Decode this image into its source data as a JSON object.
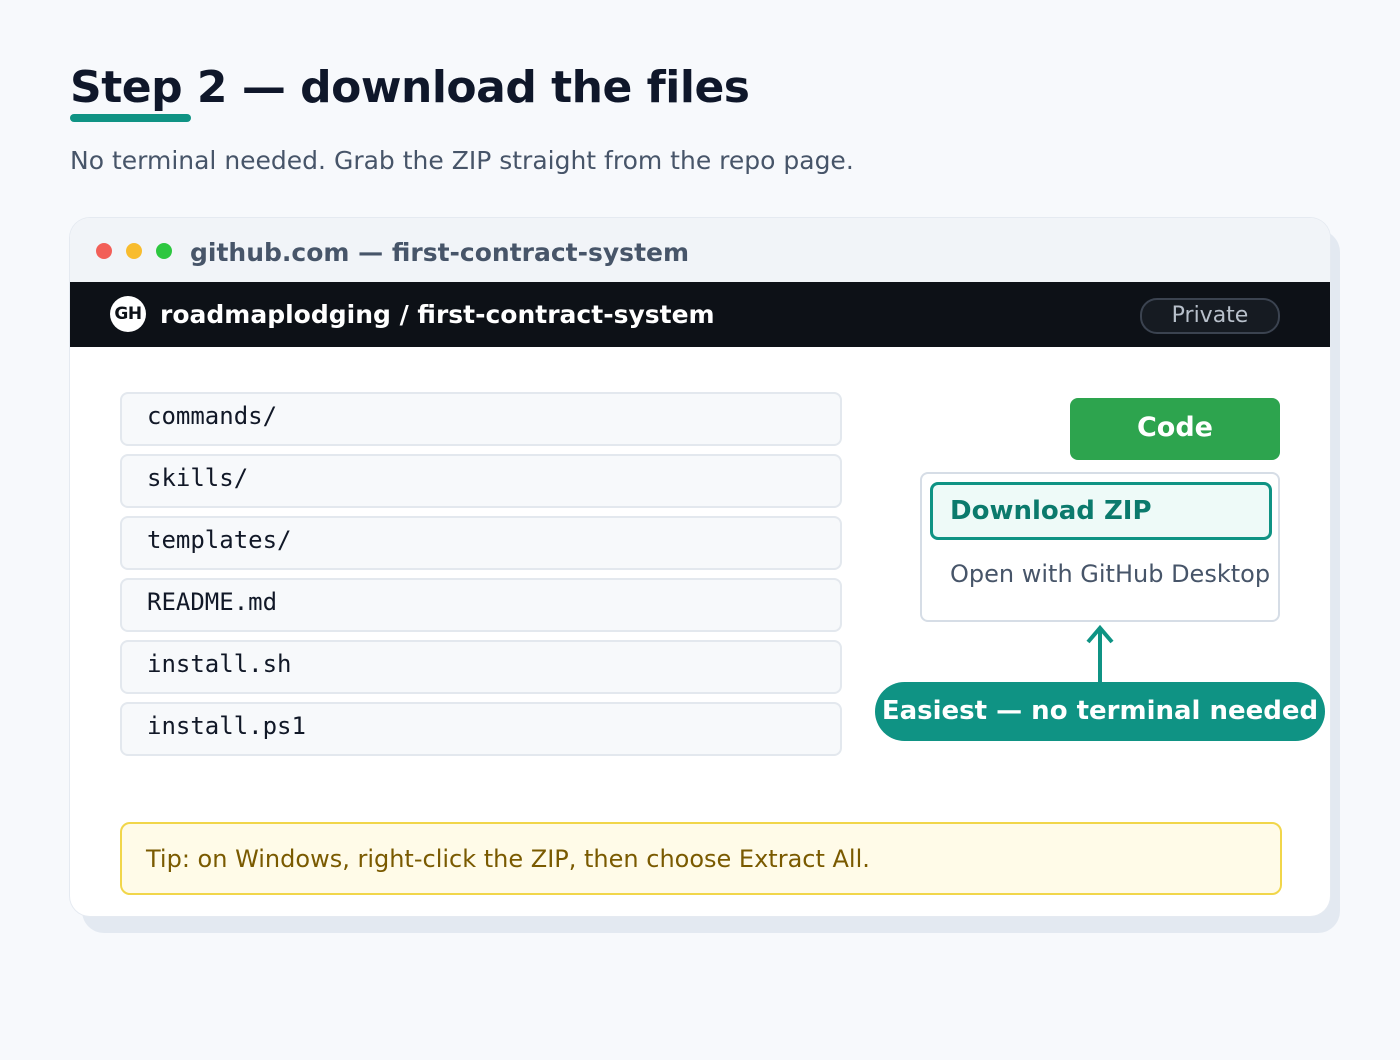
{
  "page": {
    "title": "Step 2 — download the files",
    "subtitle": "No terminal needed. Grab the ZIP straight from the repo page."
  },
  "window": {
    "title": "github.com — first-contract-system"
  },
  "repo": {
    "logo_text": "GH",
    "path": "roadmaplodging / first-contract-system",
    "visibility": "Private"
  },
  "files": [
    {
      "name": "commands/"
    },
    {
      "name": "skills/"
    },
    {
      "name": "templates/"
    },
    {
      "name": "README.md"
    },
    {
      "name": "install.sh"
    },
    {
      "name": "install.ps1"
    }
  ],
  "code_menu": {
    "button_label": "Code",
    "download_zip": "Download ZIP",
    "open_desktop": "Open with GitHub Desktop"
  },
  "callout": {
    "text": "Easiest — no terminal needed"
  },
  "tip": {
    "text": "Tip: on Windows, right-click the ZIP, then choose Extract All."
  },
  "colors": {
    "accent": "#0f9384",
    "code_button": "#2da44e",
    "header_bg": "#0d1117",
    "tip_bg": "#fffbe8",
    "tip_border": "#f1d64a"
  }
}
